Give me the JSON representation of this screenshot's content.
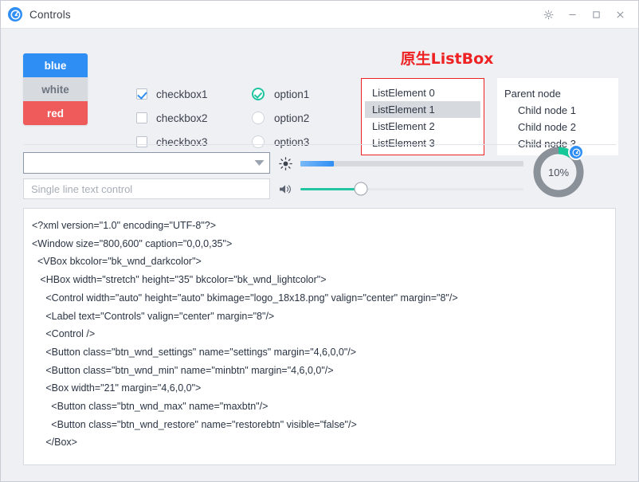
{
  "window": {
    "title": "Controls",
    "logo_icon": "app-logo-icon",
    "buttons": [
      {
        "name": "settings",
        "icon": "gear-icon"
      },
      {
        "name": "minimize",
        "icon": "minimize-icon"
      },
      {
        "name": "maximize",
        "icon": "maximize-icon"
      },
      {
        "name": "close",
        "icon": "close-icon"
      }
    ]
  },
  "color_buttons": [
    {
      "label": "blue",
      "color": "#2f8ef4"
    },
    {
      "label": "white",
      "color": "#d7dbe0"
    },
    {
      "label": "red",
      "color": "#ef5a5a"
    }
  ],
  "checkboxes": [
    {
      "label": "checkbox1",
      "checked": true
    },
    {
      "label": "checkbox2",
      "checked": false
    },
    {
      "label": "checkbox3",
      "checked": false
    }
  ],
  "radios": [
    {
      "label": "option1",
      "selected": true
    },
    {
      "label": "option2",
      "selected": false
    },
    {
      "label": "option3",
      "selected": false
    }
  ],
  "listbox": {
    "title": "原生ListBox",
    "title_color": "#ee2222",
    "border_color": "#ee2222",
    "items": [
      {
        "label": "ListElement 0",
        "selected": false
      },
      {
        "label": "ListElement 1",
        "selected": true
      },
      {
        "label": "ListElement 2",
        "selected": false
      },
      {
        "label": "ListElement 3",
        "selected": false
      }
    ]
  },
  "tree": {
    "items": [
      {
        "label": "Parent node",
        "level": 0
      },
      {
        "label": "Child node 1",
        "level": 1
      },
      {
        "label": "Child node 2",
        "level": 1
      },
      {
        "label": "Child node 3",
        "level": 1
      }
    ]
  },
  "combobox": {
    "value": "",
    "icon": "chevron-down-icon"
  },
  "text_input": {
    "value": "",
    "placeholder": "Single line text control"
  },
  "sliders": [
    {
      "name": "brightness",
      "icon": "brightness-icon",
      "value": 15,
      "fill_color": "#2f8ef4"
    },
    {
      "name": "volume",
      "icon": "volume-icon",
      "value": 27,
      "fill_color": "#22c6a2"
    }
  ],
  "circle_progress": {
    "label": "10%",
    "value": 10,
    "track_color": "#8b9199",
    "fill_color": "#16c79a",
    "knob_color": "#2f8ef4",
    "knob_icon": "app-logo-icon"
  },
  "code": {
    "lines": [
      "<?xml version=\"1.0\" encoding=\"UTF-8\"?>",
      "<Window size=\"800,600\" caption=\"0,0,0,35\">",
      "  <VBox bkcolor=\"bk_wnd_darkcolor\">",
      "   <HBox width=\"stretch\" height=\"35\" bkcolor=\"bk_wnd_lightcolor\">",
      "     <Control width=\"auto\" height=\"auto\" bkimage=\"logo_18x18.png\" valign=\"center\" margin=\"8\"/>",
      "     <Label text=\"Controls\" valign=\"center\" margin=\"8\"/>",
      "     <Control />",
      "     <Button class=\"btn_wnd_settings\" name=\"settings\" margin=\"4,6,0,0\"/>",
      "     <Button class=\"btn_wnd_min\" name=\"minbtn\" margin=\"4,6,0,0\"/>",
      "     <Box width=\"21\" margin=\"4,6,0,0\">",
      "       <Button class=\"btn_wnd_max\" name=\"maxbtn\"/>",
      "       <Button class=\"btn_wnd_restore\" name=\"restorebtn\" visible=\"false\"/>",
      "     </Box>"
    ]
  }
}
